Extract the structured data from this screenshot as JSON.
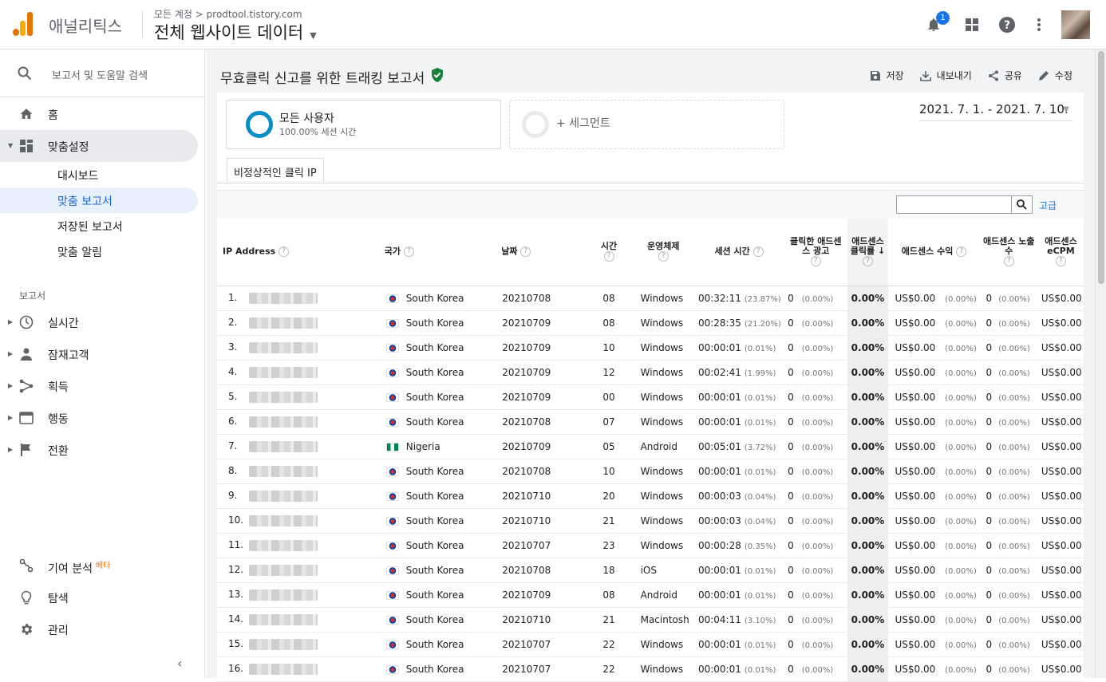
{
  "header": {
    "app_name": "애널리틱스",
    "breadcrumb": "모든 계정 > prodtool.tistory.com",
    "property": "전체 웹사이트 데이터",
    "notification_count": "1"
  },
  "sidebar": {
    "search_placeholder": "보고서 및 도움말 검색",
    "home": "홈",
    "customization": "맞춤설정",
    "sub_items": [
      "대시보드",
      "맞춤 보고서",
      "저장된 보고서",
      "맞춤 알림"
    ],
    "reports_section": "보고서",
    "report_items": [
      "실시간",
      "잠재고객",
      "획득",
      "행동",
      "전환"
    ],
    "bottom_items": [
      "기여 분석",
      "탐색",
      "관리"
    ],
    "beta_label": "베타"
  },
  "report": {
    "title": "무효클릭 신고를 위한 트래킹 보고서",
    "actions": [
      "저장",
      "내보내기",
      "공유",
      "수정"
    ],
    "segment_name": "모든 사용자",
    "segment_sub": "100.00% 세션 시간",
    "add_segment": "+ 세그먼트",
    "date_range": "2021. 7. 1. - 2021. 7. 10.",
    "tab": "비정상적인 클릭 IP",
    "advanced": "고급"
  },
  "table": {
    "columns": [
      "IP Address",
      "국가",
      "날짜",
      "시간",
      "운영체제",
      "세션 시간",
      "클릭한 애드센스 광고",
      "애드센스 클릭률",
      "애드센스 수익",
      "애드센스 노출수",
      "애드센스 eCPM"
    ],
    "rows": [
      {
        "n": "1.",
        "country": "South Korea",
        "flag": "kr",
        "date": "20210708",
        "hour": "08",
        "os": "Windows",
        "session": "00:32:11",
        "session_pct": "(23.87%)"
      },
      {
        "n": "2.",
        "country": "South Korea",
        "flag": "kr",
        "date": "20210709",
        "hour": "08",
        "os": "Windows",
        "session": "00:28:35",
        "session_pct": "(21.20%)"
      },
      {
        "n": "3.",
        "country": "South Korea",
        "flag": "kr",
        "date": "20210709",
        "hour": "10",
        "os": "Windows",
        "session": "00:00:01",
        "session_pct": "(0.01%)"
      },
      {
        "n": "4.",
        "country": "South Korea",
        "flag": "kr",
        "date": "20210709",
        "hour": "12",
        "os": "Windows",
        "session": "00:02:41",
        "session_pct": "(1.99%)"
      },
      {
        "n": "5.",
        "country": "South Korea",
        "flag": "kr",
        "date": "20210709",
        "hour": "00",
        "os": "Windows",
        "session": "00:00:01",
        "session_pct": "(0.01%)"
      },
      {
        "n": "6.",
        "country": "South Korea",
        "flag": "kr",
        "date": "20210708",
        "hour": "07",
        "os": "Windows",
        "session": "00:00:01",
        "session_pct": "(0.01%)"
      },
      {
        "n": "7.",
        "country": "Nigeria",
        "flag": "ng",
        "date": "20210709",
        "hour": "05",
        "os": "Android",
        "session": "00:05:01",
        "session_pct": "(3.72%)"
      },
      {
        "n": "8.",
        "country": "South Korea",
        "flag": "kr",
        "date": "20210708",
        "hour": "10",
        "os": "Windows",
        "session": "00:00:01",
        "session_pct": "(0.01%)"
      },
      {
        "n": "9.",
        "country": "South Korea",
        "flag": "kr",
        "date": "20210710",
        "hour": "20",
        "os": "Windows",
        "session": "00:00:03",
        "session_pct": "(0.04%)"
      },
      {
        "n": "10.",
        "country": "South Korea",
        "flag": "kr",
        "date": "20210710",
        "hour": "21",
        "os": "Windows",
        "session": "00:00:03",
        "session_pct": "(0.04%)"
      },
      {
        "n": "11.",
        "country": "South Korea",
        "flag": "kr",
        "date": "20210707",
        "hour": "23",
        "os": "Windows",
        "session": "00:00:28",
        "session_pct": "(0.35%)"
      },
      {
        "n": "12.",
        "country": "South Korea",
        "flag": "kr",
        "date": "20210708",
        "hour": "18",
        "os": "iOS",
        "session": "00:00:01",
        "session_pct": "(0.01%)"
      },
      {
        "n": "13.",
        "country": "South Korea",
        "flag": "kr",
        "date": "20210709",
        "hour": "08",
        "os": "Android",
        "session": "00:00:01",
        "session_pct": "(0.01%)"
      },
      {
        "n": "14.",
        "country": "South Korea",
        "flag": "kr",
        "date": "20210710",
        "hour": "21",
        "os": "Macintosh",
        "session": "00:04:11",
        "session_pct": "(3.10%)"
      },
      {
        "n": "15.",
        "country": "South Korea",
        "flag": "kr",
        "date": "20210707",
        "hour": "22",
        "os": "Windows",
        "session": "00:00:01",
        "session_pct": "(0.01%)"
      },
      {
        "n": "16.",
        "country": "South Korea",
        "flag": "kr",
        "date": "20210707",
        "hour": "22",
        "os": "Windows",
        "session": "00:00:01",
        "session_pct": "(0.01%)"
      }
    ],
    "zero_clicks": "0",
    "zero_pct": "(0.00%)",
    "ctr": "0.00%",
    "revenue": "US$0.00",
    "impressions": "0",
    "ecpm": "US$0.00"
  }
}
